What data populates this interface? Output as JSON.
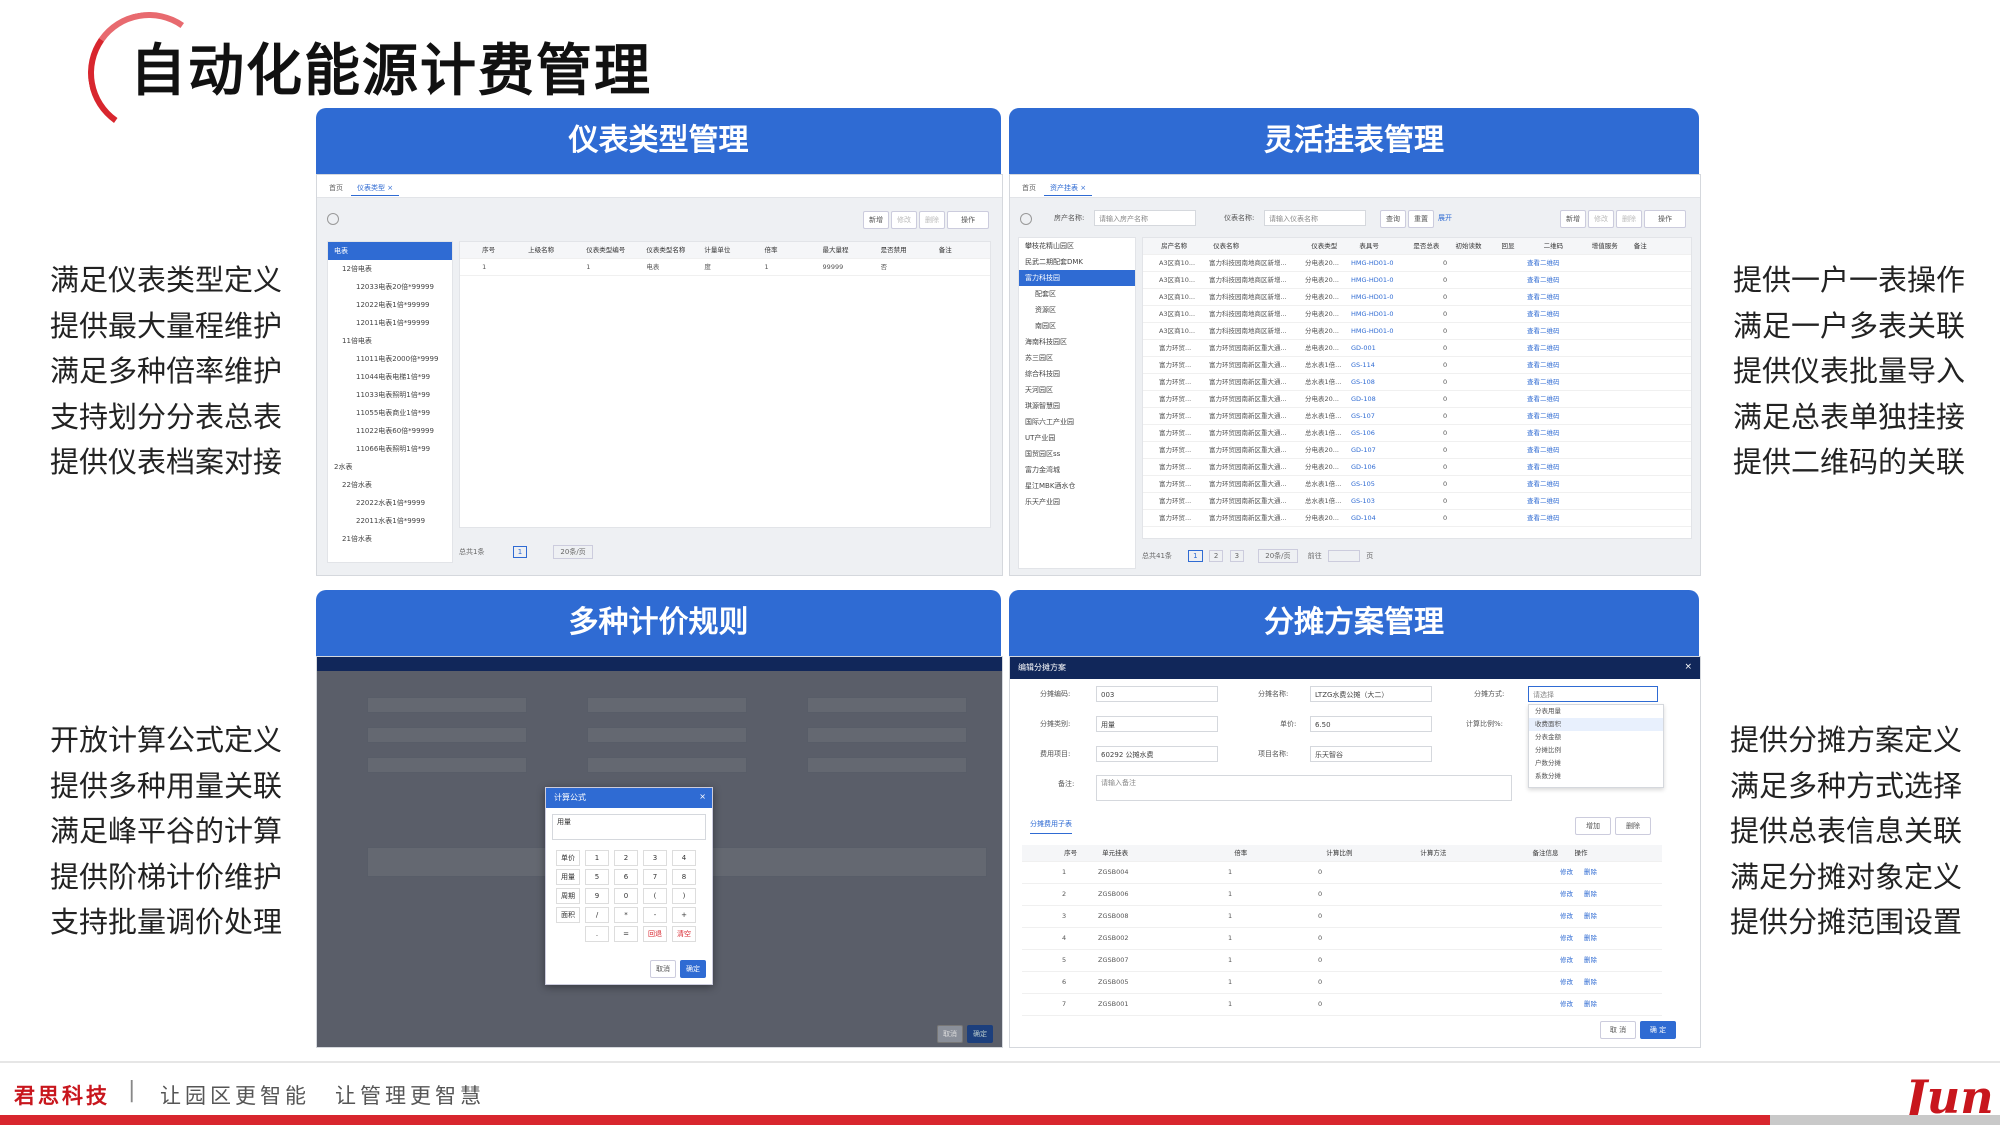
{
  "page": {
    "title": "自动化能源计费管理"
  },
  "panels": [
    {
      "title": "仪表类型管理"
    },
    {
      "title": "灵活挂表管理"
    },
    {
      "title": "多种计价规则"
    },
    {
      "title": "分摊方案管理"
    }
  ],
  "features": {
    "top_left": [
      "满足仪表类型定义",
      "提供最大量程维护",
      "满足多种倍率维护",
      "支持划分分表总表",
      "提供仪表档案对接"
    ],
    "top_right": [
      "提供一户一表操作",
      "满足一户多表关联",
      "提供仪表批量导入",
      "满足总表单独挂接",
      "提供二维码的关联"
    ],
    "bottom_left": [
      "开放计算公式定义",
      "提供多种用量关联",
      "满足峰平谷的计算",
      "提供阶梯计价维护",
      "支持批量调价处理"
    ],
    "bottom_right": [
      "提供分摊方案定义",
      "满足多种方式选择",
      "提供总表信息关联",
      "满足分摊对象定义",
      "提供分摊范围设置"
    ]
  },
  "shot1": {
    "tabs": [
      "首页",
      "仪表类型 ×"
    ],
    "buttons": [
      "新增",
      "修改",
      "删除",
      "操作"
    ],
    "tree": [
      "电表",
      "12倍电表",
      "12033电表20倍*99999",
      "12022电表1倍*99999",
      "12011电表1倍*99999",
      "11倍电表",
      "11011电表2000倍*9999",
      "11044电表电梯1倍*99",
      "11033电表照明1倍*99",
      "11055电表商业1倍*99",
      "11022电表60倍*99999",
      "11066电表照明1倍*99",
      "2水表",
      "22倍水表",
      "22022水表1倍*9999",
      "22011水表1倍*9999",
      "21倍水表"
    ],
    "columns": [
      "序号",
      "上级名称",
      "仪表类型编号",
      "仪表类型名称",
      "计量单位",
      "倍率",
      "最大量程",
      "是否禁用",
      "备注"
    ],
    "row": [
      "1",
      "",
      "1",
      "电表",
      "度",
      "1",
      "99999",
      "否",
      ""
    ],
    "pager": {
      "total": "总共1条",
      "page": "1",
      "size": "20条/页"
    }
  },
  "shot2": {
    "tabs": [
      "首页",
      "资产挂表 ×"
    ],
    "search": {
      "name_label": "房产名称:",
      "name_ph": "请输入房产名称",
      "meter_label": "仪表名称:",
      "meter_ph": "请输入仪表名称",
      "query": "查询",
      "reset": "重置",
      "expand": "展开"
    },
    "buttons": [
      "新增",
      "修改",
      "删除",
      "操作"
    ],
    "tree": [
      "攀枝花精山园区",
      "民武二期配套DMK",
      "富力科技园",
      "配套区",
      "资源区",
      "南园区",
      "海南科技园区",
      "苏三园区",
      "综合科技园",
      "天河园区",
      "琪源智慧园",
      "国际六工产业园",
      "UT产业园",
      "国贸园区ss",
      "富力金湾城",
      "星江MBK酒水仓",
      "乐天产业园"
    ],
    "columns": [
      "房产名称",
      "仪表名称",
      "仪表类型",
      "表具号",
      "是否总表",
      "初始读数",
      "回显",
      "二维码",
      "增值服务",
      "备注"
    ],
    "rows": [
      [
        "A3区商10...",
        "富力科技园南地商区新增...",
        "分电表20...",
        "HMG-HD01-0",
        "",
        "0",
        "",
        "查看二维码"
      ],
      [
        "A3区商10...",
        "富力科技园南地商区新增...",
        "分电表20...",
        "HMG-HD01-0",
        "",
        "0",
        "",
        "查看二维码"
      ],
      [
        "A3区商10...",
        "富力科技园南地商区新增...",
        "分电表20...",
        "HMG-HD01-0",
        "",
        "0",
        "",
        "查看二维码"
      ],
      [
        "A3区商10...",
        "富力科技园南地商区新增...",
        "分电表20...",
        "HMG-HD01-0",
        "",
        "0",
        "",
        "查看二维码"
      ],
      [
        "A3区商10...",
        "富力科技园南地商区新增...",
        "分电表20...",
        "HMG-HD01-0",
        "",
        "0",
        "",
        "查看二维码"
      ],
      [
        "富力环贸...",
        "富力环贸园南新区重大通...",
        "总电表20...",
        "GD-001",
        "",
        "0",
        "",
        "查看二维码"
      ],
      [
        "富力环贸...",
        "富力环贸园南新区重大通...",
        "总水表1倍...",
        "GS-114",
        "",
        "0",
        "",
        "查看二维码"
      ],
      [
        "富力环贸...",
        "富力环贸园南新区重大通...",
        "总水表1倍...",
        "GS-108",
        "",
        "0",
        "",
        "查看二维码"
      ],
      [
        "富力环贸...",
        "富力环贸园南新区重大通...",
        "分电表20...",
        "GD-108",
        "",
        "0",
        "",
        "查看二维码"
      ],
      [
        "富力环贸...",
        "富力环贸园南新区重大通...",
        "总水表1倍...",
        "GS-107",
        "",
        "0",
        "",
        "查看二维码"
      ],
      [
        "富力环贸...",
        "富力环贸园南新区重大通...",
        "总水表1倍...",
        "GS-106",
        "",
        "0",
        "",
        "查看二维码"
      ],
      [
        "富力环贸...",
        "富力环贸园南新区重大通...",
        "分电表20...",
        "GD-107",
        "",
        "0",
        "",
        "查看二维码"
      ],
      [
        "富力环贸...",
        "富力环贸园南新区重大通...",
        "分电表20...",
        "GD-106",
        "",
        "0",
        "",
        "查看二维码"
      ],
      [
        "富力环贸...",
        "富力环贸园南新区重大通...",
        "总水表1倍...",
        "GS-105",
        "",
        "0",
        "",
        "查看二维码"
      ],
      [
        "富力环贸...",
        "富力环贸园南新区重大通...",
        "总水表1倍...",
        "GS-103",
        "",
        "0",
        "",
        "查看二维码"
      ],
      [
        "富力环贸...",
        "富力环贸园南新区重大通...",
        "分电表20...",
        "GD-104",
        "",
        "0",
        "",
        "查看二维码"
      ]
    ],
    "pager": {
      "total": "总共41条",
      "pages": [
        "1",
        "2",
        "3"
      ],
      "size": "20条/页",
      "goto": "前往",
      "page_unit": "页"
    }
  },
  "shot3": {
    "formula_dialog": {
      "title": "计算公式",
      "input": "用量",
      "cancel": "取消",
      "confirm": "确定",
      "keys": [
        [
          "单价",
          "1",
          "2",
          "3",
          "4"
        ],
        [
          "用量",
          "5",
          "6",
          "7",
          "8"
        ],
        [
          "周期",
          "9",
          "0",
          "(",
          ")"
        ],
        [
          "面积",
          "/",
          "*",
          "-",
          "+"
        ],
        [
          "",
          ".",
          "=",
          "回退",
          "清空"
        ]
      ]
    },
    "bg_footer": [
      "取消",
      "确定"
    ]
  },
  "shot4": {
    "dialog_title": "编辑分摊方案",
    "fields": {
      "code_label": "分摊编码:",
      "code_value": "003",
      "name_label": "分摊名称:",
      "name_value": "LTZG水费公摊（大二）",
      "method_label": "分摊方式:",
      "method_ph": "请选择",
      "type_label": "分摊类别:",
      "type_value": "用量",
      "price_label": "单价:",
      "price_value": "6.50",
      "ratio_label": "计算比例%:",
      "fee_label": "费用项目:",
      "fee_value": "60292 公摊水费",
      "project_label": "项目名称:",
      "project_value": "乐天智谷",
      "note_label": "备注:",
      "note_ph": "请输入备注"
    },
    "method_options": [
      "分表用量",
      "收费面积",
      "分表金额",
      "分摊比例",
      "户数分摊",
      "系数分摊"
    ],
    "subtab": "分摊费用子表",
    "sub_buttons": [
      "增加",
      "删除"
    ],
    "columns": [
      "序号",
      "单元挂表",
      "倍率",
      "计算比例",
      "计算方法",
      "备注信息",
      "操作"
    ],
    "rows": [
      [
        "1",
        "ZGSB004",
        "1",
        "0"
      ],
      [
        "2",
        "ZGSB006",
        "1",
        "0"
      ],
      [
        "3",
        "ZGSB008",
        "1",
        "0"
      ],
      [
        "4",
        "ZGSB002",
        "1",
        "0"
      ],
      [
        "5",
        "ZGSB007",
        "1",
        "0"
      ],
      [
        "6",
        "ZGSB005",
        "1",
        "0"
      ],
      [
        "7",
        "ZGSB001",
        "1",
        "0"
      ]
    ],
    "row_actions": [
      "修改",
      "删除"
    ],
    "footer": [
      "取 消",
      "确 定"
    ]
  },
  "footer": {
    "brand": "君思科技",
    "separator": "|",
    "slogan": "让园区更智能　让管理更智慧",
    "logo_text": "Jun",
    "logo_sub": "君思科技"
  },
  "colors": {
    "accent": "#2f6bd3",
    "brand_red": "#c8161d"
  }
}
